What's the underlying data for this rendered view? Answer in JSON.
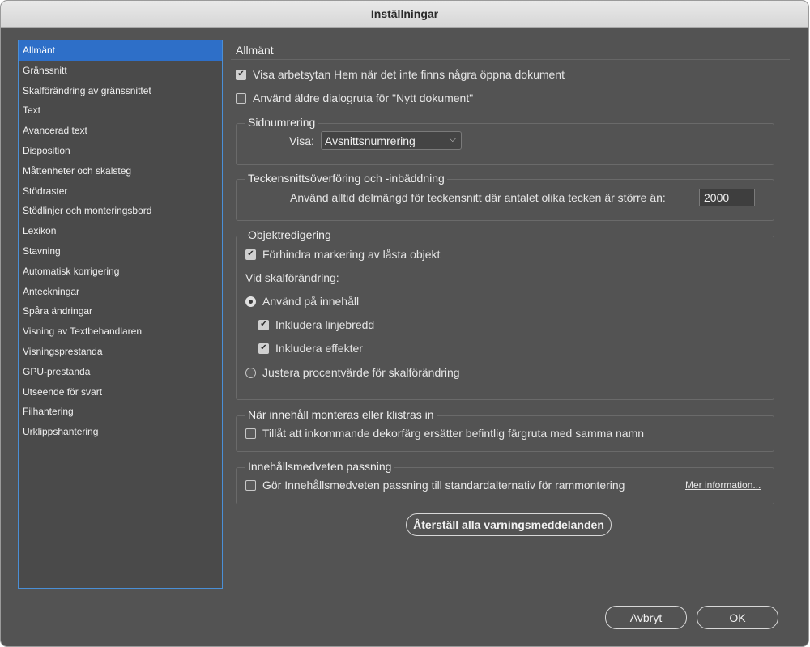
{
  "window": {
    "title": "Inställningar"
  },
  "sidebar": {
    "items": [
      {
        "label": "Allmänt",
        "selected": true
      },
      {
        "label": "Gränssnitt"
      },
      {
        "label": "Skalförändring av gränssnittet"
      },
      {
        "label": "Text"
      },
      {
        "label": "Avancerad text"
      },
      {
        "label": "Disposition"
      },
      {
        "label": "Måttenheter och skalsteg"
      },
      {
        "label": "Stödraster"
      },
      {
        "label": "Stödlinjer och monteringsbord"
      },
      {
        "label": "Lexikon"
      },
      {
        "label": "Stavning"
      },
      {
        "label": "Automatisk korrigering"
      },
      {
        "label": "Anteckningar"
      },
      {
        "label": "Spåra ändringar"
      },
      {
        "label": "Visning av Textbehandlaren"
      },
      {
        "label": "Visningsprestanda"
      },
      {
        "label": "GPU-prestanda"
      },
      {
        "label": "Utseende för svart"
      },
      {
        "label": "Filhantering"
      },
      {
        "label": "Urklippshantering"
      }
    ]
  },
  "main": {
    "title": "Allmänt",
    "show_home": {
      "label": "Visa arbetsytan Hem när det inte finns några öppna dokument",
      "checked": true
    },
    "legacy_dialog": {
      "label": "Använd äldre dialogruta för \"Nytt dokument\"",
      "checked": false
    },
    "page_numbering": {
      "title": "Sidnumrering",
      "view_label": "Visa:",
      "view_value": "Avsnittsnumrering"
    },
    "font_embedding": {
      "title": "Teckensnittsöverföring och -inbäddning",
      "subset_label": "Använd alltid delmängd för teckensnitt där antalet olika tecken är större än:",
      "subset_value": "2000"
    },
    "object_editing": {
      "title": "Objektredigering",
      "prevent_locked": {
        "label": "Förhindra markering av låsta objekt",
        "checked": true
      },
      "scaling_label": "Vid skalförändring:",
      "apply_content": {
        "label": "Använd på innehåll",
        "checked": true
      },
      "include_stroke": {
        "label": "Inkludera linjebredd",
        "checked": true
      },
      "include_effects": {
        "label": "Inkludera effekter",
        "checked": true
      },
      "adjust_percent": {
        "label": "Justera procentvärde för skalförändring",
        "checked": false
      }
    },
    "paste": {
      "title": "När innehåll monteras eller klistras in",
      "allow_swatch": {
        "label": "Tillåt att inkommande dekorfärg ersätter befintlig färgruta med samma namn",
        "checked": false
      }
    },
    "content_aware": {
      "title": "Innehållsmedveten passning",
      "default_fit": {
        "label": "Gör Innehållsmedveten passning till standardalternativ för rammontering",
        "checked": false
      },
      "more_info": "Mer information..."
    },
    "reset_warnings": "Återställ alla varningsmeddelanden"
  },
  "footer": {
    "cancel": "Avbryt",
    "ok": "OK"
  }
}
